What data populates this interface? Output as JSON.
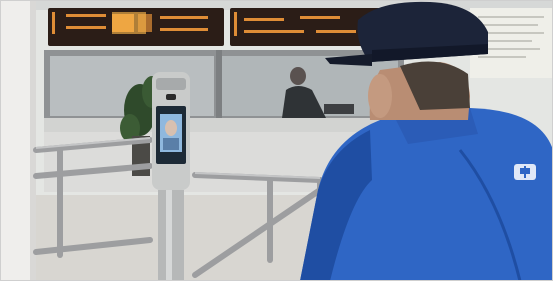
{
  "photo": {
    "subject": "worker-using-face-recognition-terminal",
    "text": {
      "led_sign": "",
      "jacket_logo": ""
    },
    "colors": {
      "wall": "#e4e6e3",
      "led_panel": "#2b1d17",
      "led_glow": "#f39a3a",
      "window_glass": "#b9bec0",
      "window_frame": "#8f9294",
      "terminal_body": "#c9cbca",
      "terminal_screen": "#1d2a36",
      "screen_face": "#8fb8de",
      "jacket": "#2f66c5",
      "jacket_shadow": "#1f4ea3",
      "cap": "#1c2439",
      "skin": "#b98d73",
      "railing": "#9d9ea0",
      "floor": "#d8d6d1",
      "plant": "#2f4a2b"
    }
  }
}
